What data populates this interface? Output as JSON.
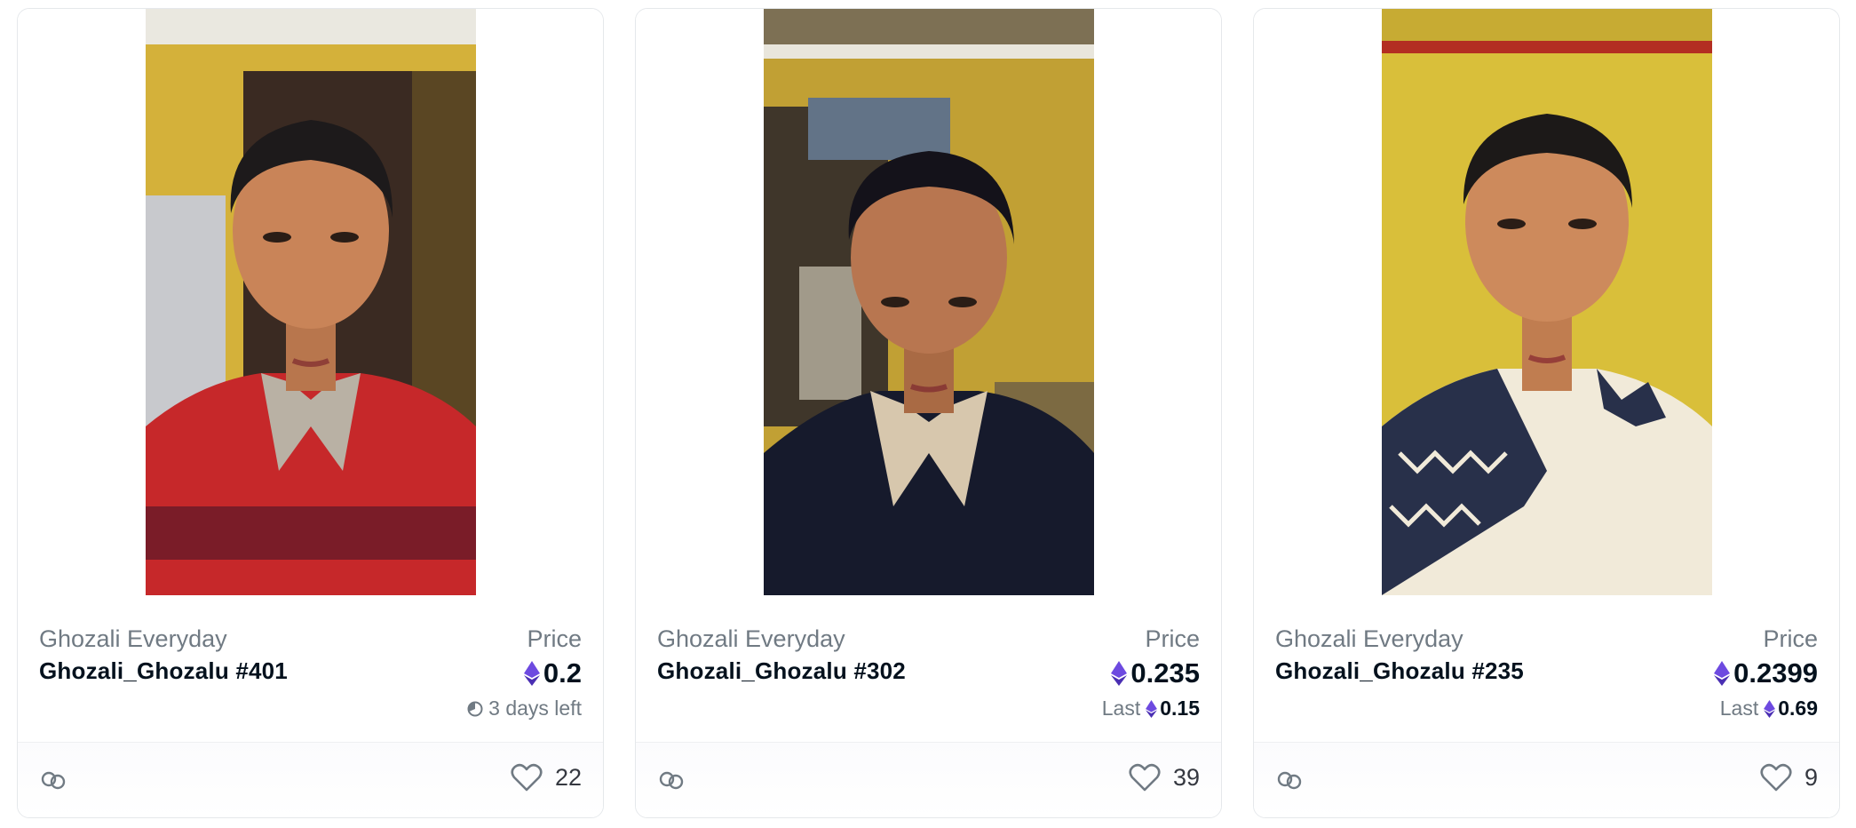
{
  "cards": [
    {
      "collection": "Ghozali Everyday",
      "name": "Ghozali_Ghozalu #401",
      "price_label": "Price",
      "price": "0.2",
      "sub_text": "3 days left",
      "likes": "22",
      "photo_palette": {
        "wall": "#d7b43c",
        "shirt_main": "#c6282a",
        "shirt_accent": "#b9b1a4"
      }
    },
    {
      "collection": "Ghozali Everyday",
      "name": "Ghozali_Ghozalu #302",
      "price_label": "Price",
      "price": "0.235",
      "last_label": "Last",
      "last_price": "0.15",
      "likes": "39",
      "photo_palette": {
        "wall": "#c2a134",
        "shirt_main": "#161a2c",
        "shirt_accent": "#d7c7ad"
      }
    },
    {
      "collection": "Ghozali Everyday",
      "name": "Ghozali_Ghozalu #235",
      "price_label": "Price",
      "price": "0.2399",
      "last_label": "Last",
      "last_price": "0.69",
      "likes": "9",
      "photo_palette": {
        "wall": "#d9bf3a",
        "shirt_main": "#f1ead9",
        "shirt_accent": "#28304a"
      }
    }
  ],
  "icons": {
    "currency": "ethereum-icon",
    "timer": "clock-icon",
    "link": "chain-link-icon",
    "like": "heart-icon"
  },
  "colors": {
    "eth_purple": "#6d4ae0",
    "muted_text": "#707a83",
    "primary_text": "#04111d"
  }
}
